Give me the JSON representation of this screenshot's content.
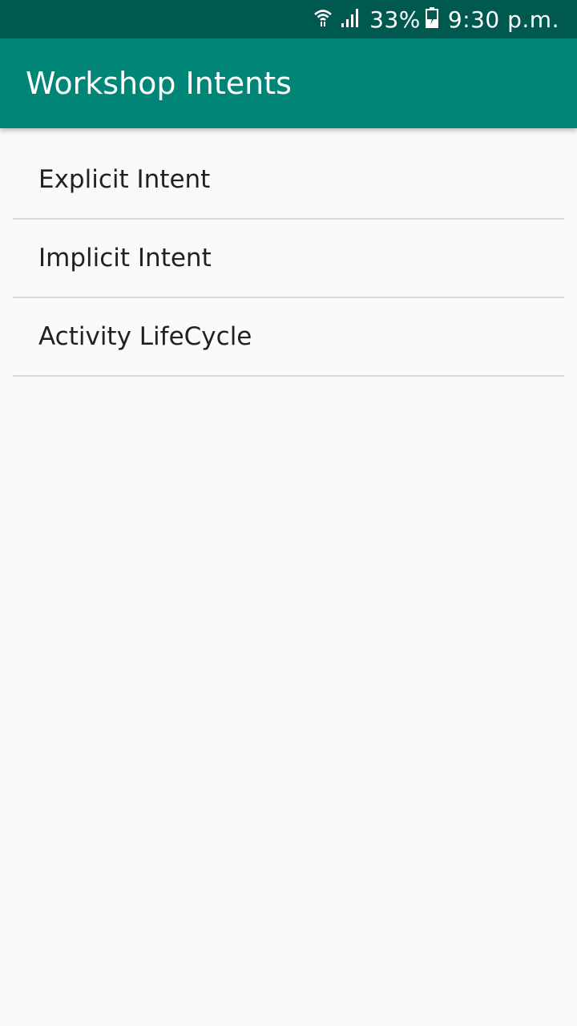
{
  "status_bar": {
    "battery_percent": "33%",
    "time": "9:30 p.m.",
    "icons": [
      "wifi-icon",
      "signal-icon",
      "battery-charging-icon"
    ]
  },
  "app_bar": {
    "title": "Workshop Intents",
    "color": "#008577",
    "status_color": "#00594f"
  },
  "list": {
    "items": [
      {
        "label": "Explicit Intent"
      },
      {
        "label": "Implicit Intent"
      },
      {
        "label": "Activity LifeCycle"
      }
    ]
  }
}
